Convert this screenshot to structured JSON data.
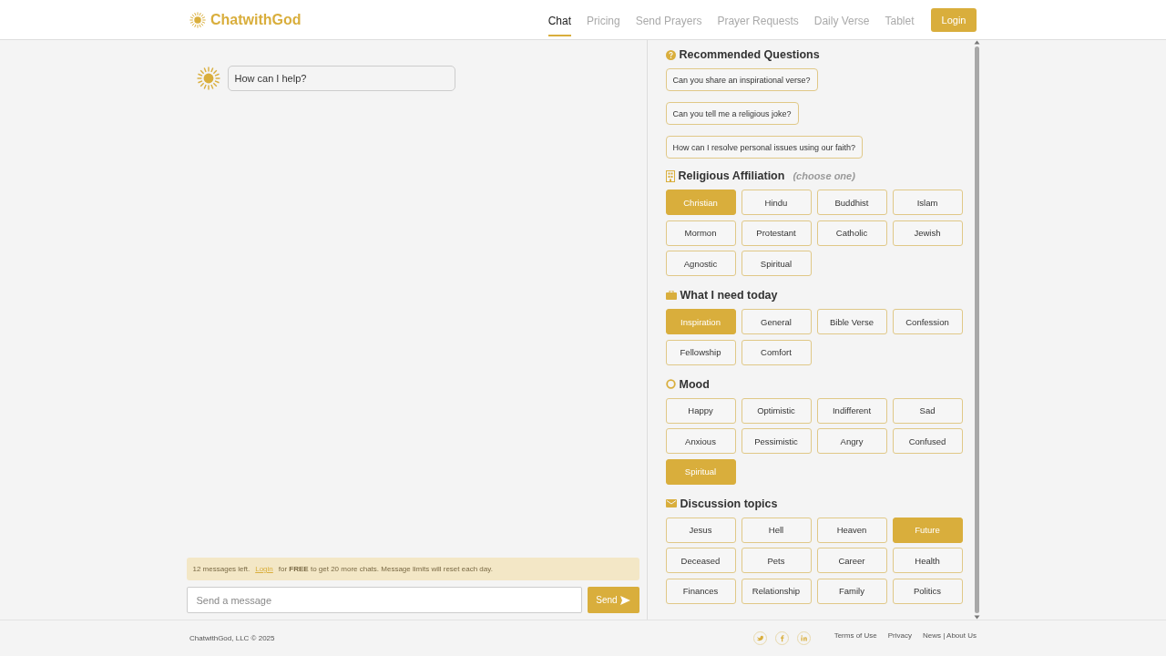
{
  "header": {
    "logo": "ChatwithGod",
    "nav": [
      {
        "label": "Chat",
        "selected": true
      },
      {
        "label": "Pricing",
        "selected": false
      },
      {
        "label": "Send Prayers",
        "selected": false
      },
      {
        "label": "Prayer Requests",
        "selected": false
      },
      {
        "label": "Daily Verse",
        "selected": false
      },
      {
        "label": "Tablet",
        "selected": false
      }
    ],
    "login": "Login"
  },
  "chat": {
    "messages": [
      "How can I help?"
    ],
    "notice": {
      "before": "12 messages left.",
      "link": "Login",
      "after": "for **FREE** to get 20 more chats. Message limits will reset each day."
    },
    "input": {
      "placeholder": "Send a message"
    },
    "send": "Send"
  },
  "panel": {
    "recommended": {
      "title": "Recommended Questions",
      "questions": [
        "Can you share an inspirational verse?",
        "Can you tell me a religious joke?",
        "How can I resolve personal issues using our faith?"
      ]
    },
    "groups": [
      {
        "title": "Religious Affiliation",
        "hint": "(choose one)",
        "options": [
          {
            "label": "Christian",
            "selected": true
          },
          {
            "label": "Hindu",
            "selected": false
          },
          {
            "label": "Buddhist",
            "selected": false
          },
          {
            "label": "Islam",
            "selected": false
          },
          {
            "label": "Mormon",
            "selected": false
          },
          {
            "label": "Protestant",
            "selected": false
          },
          {
            "label": "Catholic",
            "selected": false
          },
          {
            "label": "Jewish",
            "selected": false
          },
          {
            "label": "Agnostic",
            "selected": false
          },
          {
            "label": "Spiritual",
            "selected": false
          }
        ]
      },
      {
        "title": "What I need today",
        "options": [
          {
            "label": "Inspiration",
            "selected": true
          },
          {
            "label": "General",
            "selected": false
          },
          {
            "label": "Bible Verse",
            "selected": false
          },
          {
            "label": "Confession",
            "selected": false
          },
          {
            "label": "Fellowship",
            "selected": false
          },
          {
            "label": "Comfort",
            "selected": false
          }
        ]
      },
      {
        "title": "Mood",
        "options": [
          {
            "label": "Happy",
            "selected": false
          },
          {
            "label": "Optimistic",
            "selected": false
          },
          {
            "label": "Indifferent",
            "selected": false
          },
          {
            "label": "Sad",
            "selected": false
          },
          {
            "label": "Anxious",
            "selected": false
          },
          {
            "label": "Pessimistic",
            "selected": false
          },
          {
            "label": "Angry",
            "selected": false
          },
          {
            "label": "Confused",
            "selected": false
          },
          {
            "label": "Spiritual",
            "selected": true
          }
        ]
      },
      {
        "title": "Discussion topics",
        "options": [
          {
            "label": "Jesus",
            "selected": false
          },
          {
            "label": "Hell",
            "selected": false
          },
          {
            "label": "Heaven",
            "selected": false
          },
          {
            "label": "Future",
            "selected": true
          },
          {
            "label": "Deceased",
            "selected": false
          },
          {
            "label": "Pets",
            "selected": false
          },
          {
            "label": "Career",
            "selected": false
          },
          {
            "label": "Health",
            "selected": false
          },
          {
            "label": "Finances",
            "selected": false
          },
          {
            "label": "Relationship",
            "selected": false
          },
          {
            "label": "Family",
            "selected": false
          },
          {
            "label": "Politics",
            "selected": false
          }
        ]
      }
    ]
  },
  "footer": {
    "copyright": "ChatwithGod, LLC © 2025",
    "links": [
      "Terms of Use",
      "Privacy",
      "News | About Us"
    ]
  }
}
